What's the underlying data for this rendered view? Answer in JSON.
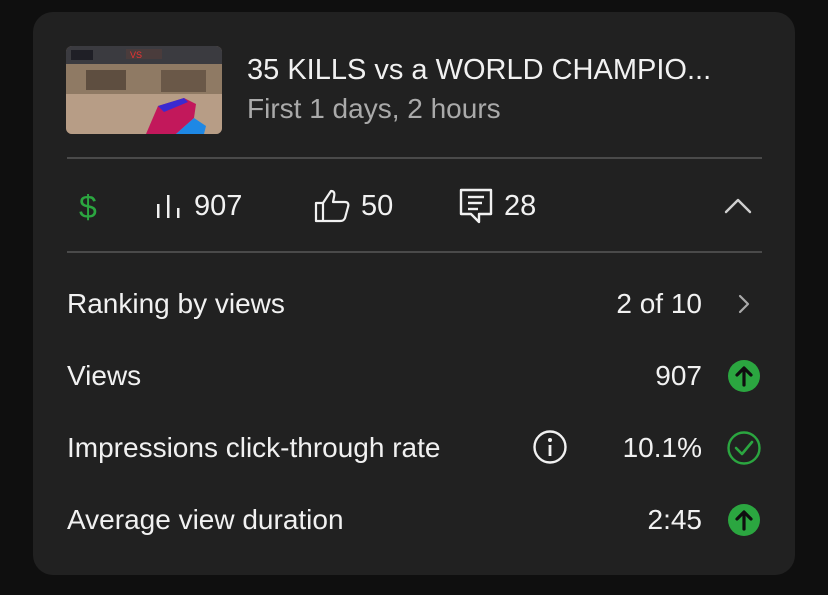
{
  "video": {
    "title": "35 KILLS vs a WORLD CHAMPIO...",
    "subtitle": "First 1 days, 2 hours",
    "thumbnail_icon": "game-thumbnail"
  },
  "stats": {
    "revenue_icon": "dollar-icon",
    "views_count": "907",
    "likes_count": "50",
    "comments_count": "28",
    "collapse_icon": "chevron-up-icon"
  },
  "metrics": [
    {
      "label": "Ranking by views",
      "value": "2 of 10",
      "status_icon": "chevron-right-icon"
    },
    {
      "label": "Views",
      "value": "907",
      "status_icon": "arrow-up-circle-icon"
    },
    {
      "label": "Impressions click-through rate",
      "value": "10.1%",
      "status_icon": "check-circle-icon"
    },
    {
      "label": "Average view duration",
      "value": "2:45",
      "status_icon": "arrow-up-circle-icon"
    }
  ],
  "colors": {
    "background": "#0f0f0f",
    "card": "#212121",
    "accent_green": "#2ba640",
    "text_primary": "#f1f1f1",
    "text_secondary": "#aaaaaa"
  }
}
